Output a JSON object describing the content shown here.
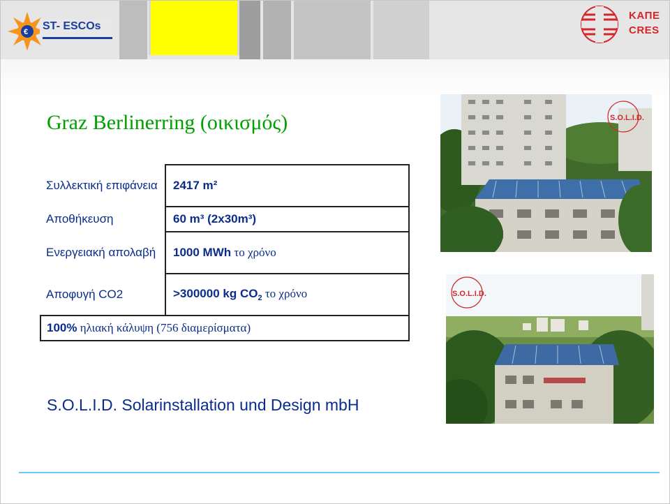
{
  "header": {
    "left_logo_text": "ST- ESCOs",
    "right_logo_gr": "ΚΑΠΕ",
    "right_logo_en": "CRES"
  },
  "title": "Graz Berlinerring (οικισμός)",
  "table": {
    "rows": [
      {
        "label": "Συλλεκτική επιφάνεια",
        "value": "2417 m²"
      },
      {
        "label": "Αποθήκευση",
        "value": "60 m³ (2x30m³)"
      },
      {
        "label": "Ενεργειακή απολαβή",
        "value_bold": "1000 MWh",
        "value_suffix": " το χρόνο"
      },
      {
        "label": "Αποφυγή CO2",
        "value_bold": ">300000 kg CO",
        "value_sub": "2",
        "value_suffix": " το χρόνο"
      }
    ],
    "full_row": {
      "bold": "100%",
      "text": " ηλιακή κάλυψη (756 διαμερίσματα)"
    }
  },
  "company": "S.O.L.I.D. Solarinstallation und Design mbH",
  "photo_logo_text": "S.O.L.I.D.",
  "colors": {
    "title": "#00a000",
    "text": "#0a2d8c",
    "accent_line": "#6cc8f0",
    "cres_red": "#d6242b"
  }
}
